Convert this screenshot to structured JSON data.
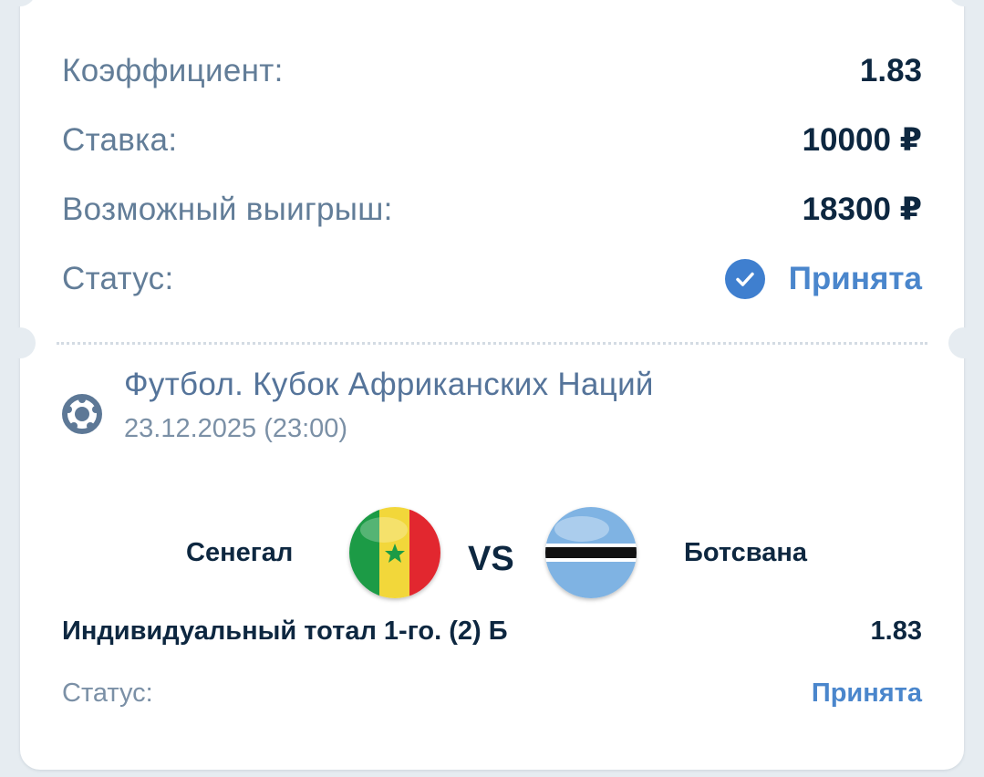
{
  "summary": {
    "coefficient_label": "Коэффициент:",
    "coefficient_value": "1.83",
    "stake_label": "Ставка:",
    "stake_value": "10000 ₽",
    "payout_label": "Возможный выигрыш:",
    "payout_value": "18300 ₽",
    "status_label": "Статус:",
    "status_value": "Принята",
    "status_icon": "check-circle-icon"
  },
  "event": {
    "icon": "soccer-ball-icon",
    "title": "Футбол. Кубок Африканских Наций",
    "datetime": "23.12.2025 (23:00)",
    "home_team": "Сенегал",
    "away_team": "Ботсвана",
    "vs_label": "VS",
    "home_flag": "senegal-flag-icon",
    "away_flag": "botswana-flag-icon"
  },
  "selection": {
    "market": "Индивидуальный тотал 1-го. (2) Б",
    "odds": "1.83",
    "status_label": "Статус:",
    "status_value": "Принята"
  },
  "colors": {
    "background": "#e6ecf1",
    "label": "#627d98",
    "value": "#0d2740",
    "accent": "#4a86cc"
  }
}
